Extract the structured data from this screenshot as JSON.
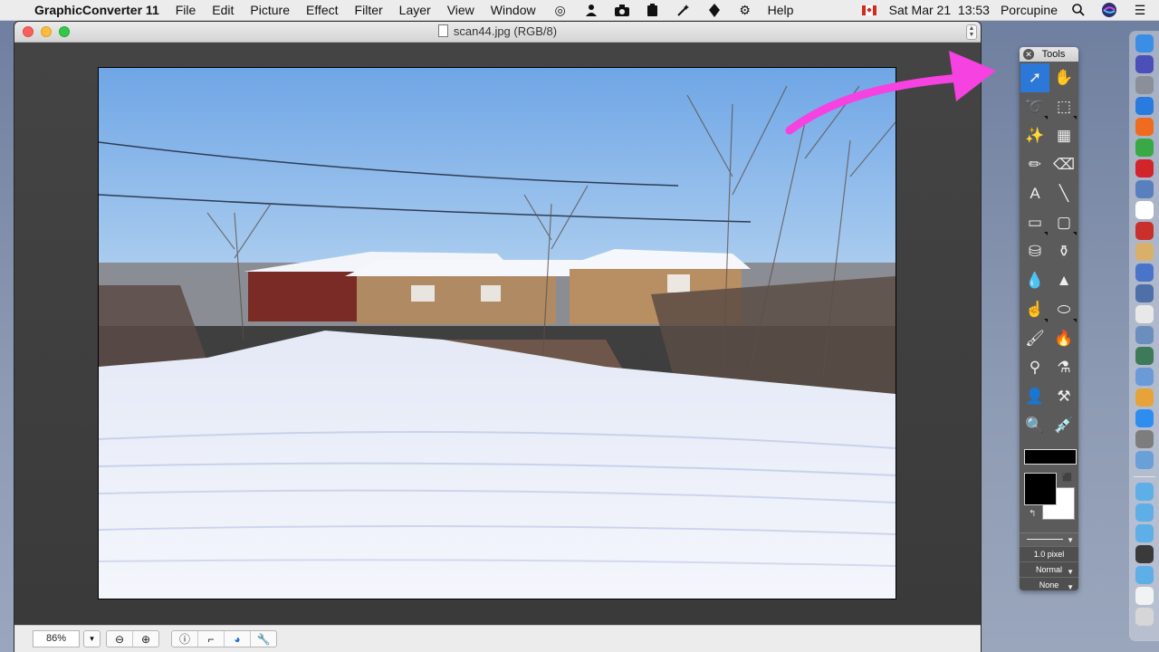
{
  "menubar": {
    "apple_icon": "apple-icon",
    "app_name": "GraphicConverter 11",
    "items": [
      "File",
      "Edit",
      "Picture",
      "Effect",
      "Filter",
      "Layer",
      "View",
      "Window",
      "Help"
    ],
    "status_icons": [
      "target-icon",
      "person-icon",
      "camera-icon",
      "clipboard-icon",
      "wand-icon",
      "pen-icon",
      "gear-icon"
    ],
    "clock": "Sat Mar 21  13:53",
    "user": "Porcupine"
  },
  "window": {
    "title": "scan44.jpg (RGB/8)"
  },
  "statusbar": {
    "zoom": "86%"
  },
  "tools": {
    "title": "Tools",
    "items": [
      {
        "name": "arrow-tool",
        "glyph": "➚",
        "active": true
      },
      {
        "name": "hand-tool",
        "glyph": "✋",
        "active": false
      },
      {
        "name": "lasso-tool",
        "glyph": "➰",
        "active": false
      },
      {
        "name": "marquee-tool",
        "glyph": "⬚",
        "active": false
      },
      {
        "name": "magic-wand-tool",
        "glyph": "✨",
        "active": false
      },
      {
        "name": "checker-tool",
        "glyph": "▦",
        "active": false
      },
      {
        "name": "pencil-tool",
        "glyph": "✏",
        "active": false
      },
      {
        "name": "eraser-tool",
        "glyph": "⌫",
        "active": false
      },
      {
        "name": "text-tool",
        "glyph": "A",
        "active": false
      },
      {
        "name": "line-tool",
        "glyph": "╲",
        "active": false
      },
      {
        "name": "rectangle-fill-tool",
        "glyph": "▭",
        "active": false
      },
      {
        "name": "rectangle-tool",
        "glyph": "▢",
        "active": false
      },
      {
        "name": "bucket-tool",
        "glyph": "⛁",
        "active": false
      },
      {
        "name": "stamp-tool",
        "glyph": "⚱",
        "active": false
      },
      {
        "name": "blur-drop-tool",
        "glyph": "💧",
        "active": false
      },
      {
        "name": "sharpen-tool",
        "glyph": "▲",
        "active": false
      },
      {
        "name": "smudge-tool",
        "glyph": "☝",
        "active": false
      },
      {
        "name": "sponge-tool",
        "glyph": "⬭",
        "active": false
      },
      {
        "name": "brush-tool",
        "glyph": "🖌",
        "active": false
      },
      {
        "name": "airbrush-tool",
        "glyph": "🔥",
        "active": false
      },
      {
        "name": "eyedropper-tool",
        "glyph": "⚲",
        "active": false
      },
      {
        "name": "color-replace-tool",
        "glyph": "⚗",
        "active": false
      },
      {
        "name": "silhouette-tool",
        "glyph": "👤",
        "active": false
      },
      {
        "name": "clone-tool",
        "glyph": "⚒",
        "active": false
      },
      {
        "name": "zoom-tool",
        "glyph": "🔍",
        "active": false
      },
      {
        "name": "syringe-tool",
        "glyph": "💉",
        "active": false
      }
    ],
    "line_width": "1.0 pixel",
    "blend_mode": "Normal",
    "fill_mode": "None"
  },
  "annotation_arrow_color": "#f542e0",
  "dock": {
    "items_top": [
      "finder-icon",
      "siri-icon",
      "launchpad-icon",
      "safari-icon",
      "firefox-icon",
      "chrome-icon",
      "opera-icon",
      "preview-icon",
      "calendar-icon",
      "acrobat-icon",
      "notes-icon",
      "graphicconverter-icon",
      "photo-browser-icon",
      "textedit-icon",
      "image-capture-icon",
      "gallery-icon",
      "preview2-icon",
      "photos-icon",
      "app-store-icon",
      "system-preferences-icon",
      "screenshot-icon"
    ],
    "items_bottom": [
      "folder-icon",
      "folder-icon",
      "folder-icon",
      "photo-booth-icon",
      "folder-icon",
      "document-icon",
      "trash-icon"
    ]
  }
}
